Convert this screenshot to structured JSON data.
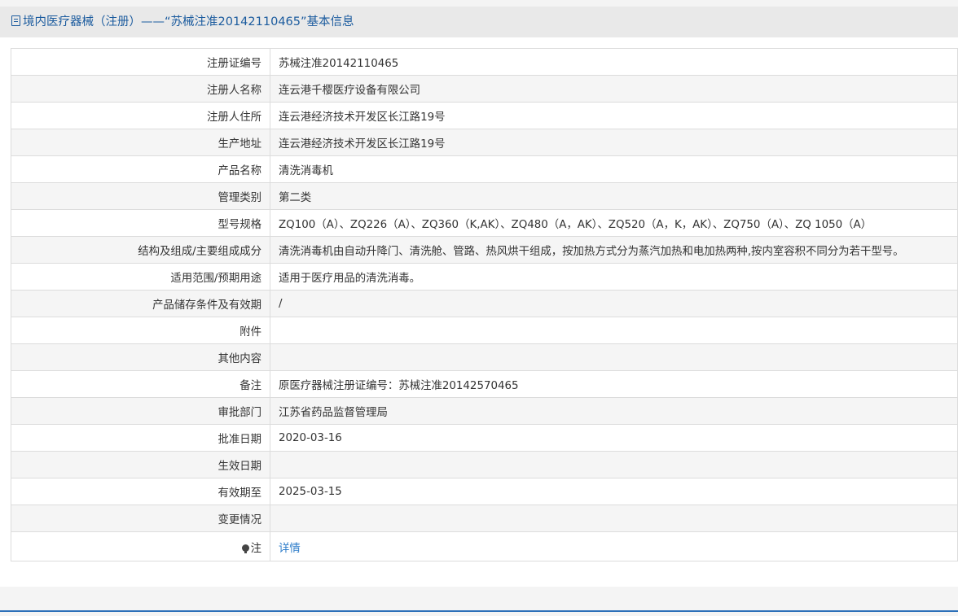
{
  "header": {
    "title": "境内医疗器械（注册）——“苏械注准20142110465”基本信息",
    "icon": "document-icon"
  },
  "rows": [
    {
      "label": "注册证编号",
      "value": "苏械注准20142110465"
    },
    {
      "label": "注册人名称",
      "value": "连云港千樱医疗设备有限公司"
    },
    {
      "label": "注册人住所",
      "value": "连云港经济技术开发区长江路19号"
    },
    {
      "label": "生产地址",
      "value": "连云港经济技术开发区长江路19号"
    },
    {
      "label": "产品名称",
      "value": "清洗消毒机"
    },
    {
      "label": "管理类别",
      "value": "第二类"
    },
    {
      "label": "型号规格",
      "value": "ZQ100（A）、ZQ226（A）、ZQ360（K,AK）、ZQ480（A，AK）、ZQ520（A，K，AK）、ZQ750（A）、ZQ 1050（A）"
    },
    {
      "label": "结构及组成/主要组成成分",
      "value": "清洗消毒机由自动升降门、清洗舱、管路、热风烘干组成，按加热方式分为蒸汽加热和电加热两种,按内室容积不同分为若干型号。"
    },
    {
      "label": "适用范围/预期用途",
      "value": "适用于医疗用品的清洗消毒。"
    },
    {
      "label": "产品储存条件及有效期",
      "value": "/"
    },
    {
      "label": "附件",
      "value": ""
    },
    {
      "label": "其他内容",
      "value": ""
    },
    {
      "label": "备注",
      "value": "原医疗器械注册证编号：苏械注准20142570465"
    },
    {
      "label": "审批部门",
      "value": "江苏省药品监督管理局"
    },
    {
      "label": "批准日期",
      "value": "2020-03-16"
    },
    {
      "label": "生效日期",
      "value": ""
    },
    {
      "label": "有效期至",
      "value": "2025-03-15"
    },
    {
      "label": "变更情况",
      "value": ""
    }
  ],
  "note": {
    "label": "注",
    "icon": "lightbulb-icon",
    "link_text": "详情"
  },
  "colors": {
    "header_text": "#1b5b9e",
    "link": "#2b7bc9",
    "border": "#dcdcdc",
    "accent_line": "#2b6fb8"
  }
}
